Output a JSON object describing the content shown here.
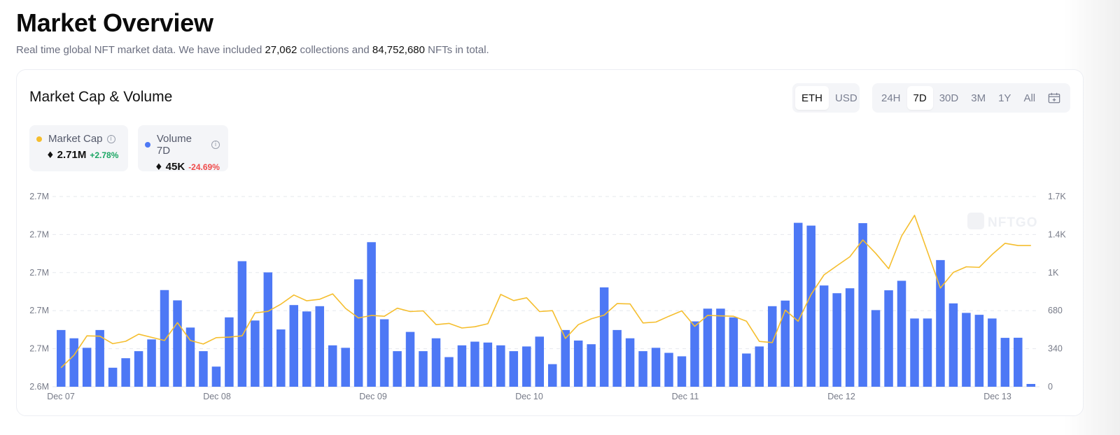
{
  "header": {
    "title": "Market Overview",
    "subtitle_prefix": "Real time global NFT market data. We have included ",
    "collections": "27,062",
    "subtitle_mid": " collections and ",
    "nfts": "84,752,680",
    "subtitle_suffix": " NFTs in total."
  },
  "card": {
    "title": "Market Cap & Volume",
    "currency_toggle": [
      {
        "label": "ETH",
        "active": true
      },
      {
        "label": "USD",
        "active": false
      }
    ],
    "range_toggle": [
      {
        "label": "24H",
        "active": false
      },
      {
        "label": "7D",
        "active": true
      },
      {
        "label": "30D",
        "active": false
      },
      {
        "label": "3M",
        "active": false
      },
      {
        "label": "1Y",
        "active": false
      },
      {
        "label": "All",
        "active": false
      }
    ],
    "calendar_icon": "calendar-icon",
    "legend": {
      "market_cap": {
        "label": "Market Cap",
        "value": "2.71M",
        "change": "+2.78%",
        "color": "#f5be2e",
        "change_color": "#1aa663"
      },
      "volume": {
        "label": "Volume 7D",
        "value": "45K",
        "change": "-24.69%",
        "color": "#4d78f5",
        "change_color": "#ef4b4b"
      }
    },
    "watermark": "NFTGO"
  },
  "chart_data": {
    "type": "bar",
    "x_tick_labels": [
      "Dec 07",
      "Dec 08",
      "Dec 09",
      "Dec 10",
      "Dec 11",
      "Dec 12",
      "Dec 13"
    ],
    "y_left_ticks": [
      "2.6M",
      "2.7M",
      "2.7M",
      "2.7M",
      "2.7M",
      "2.7M"
    ],
    "y_right_ticks": [
      "0",
      "340",
      "680",
      "1K",
      "1.4K",
      "1.7K"
    ],
    "ylim_right": [
      0,
      1700
    ],
    "grid": true,
    "series": [
      {
        "name": "Volume 7D",
        "type": "bar",
        "axis": "right",
        "color": "#4d78f5",
        "values": [
          507,
          433,
          348,
          507,
          170,
          255,
          318,
          423,
          864,
          772,
          529,
          318,
          180,
          620,
          1122,
          592,
          1022,
          512,
          730,
          673,
          720,
          370,
          348,
          960,
          1292,
          603,
          318,
          490,
          318,
          433,
          265,
          370,
          403,
          395,
          370,
          318,
          360,
          448,
          202,
          507,
          413,
          380,
          888,
          507,
          433,
          318,
          348,
          303,
          272,
          584,
          698,
          698,
          620,
          297,
          360,
          720,
          770,
          1465,
          1440,
          905,
          836,
          880,
          1462,
          685,
          862,
          947,
          610,
          610,
          1132,
          745,
          660,
          643,
          610,
          437,
          438,
          25
        ]
      },
      {
        "name": "Market Cap",
        "type": "line",
        "axis": "left_scaled",
        "color": "#f5be2e",
        "values_right_scale": [
          170,
          282,
          455,
          452,
          385,
          406,
          470,
          441,
          413,
          573,
          413,
          382,
          439,
          443,
          455,
          660,
          674,
          738,
          820,
          768,
          782,
          830,
          700,
          615,
          637,
          630,
          702,
          672,
          678,
          555,
          566,
          525,
          536,
          563,
          825,
          770,
          795,
          672,
          680,
          432,
          555,
          607,
          640,
          743,
          740,
          570,
          578,
          630,
          678,
          540,
          638,
          633,
          630,
          586,
          405,
          395,
          685,
          585,
          825,
          1000,
          1082,
          1162,
          1312,
          1192,
          1055,
          1347,
          1532,
          1206,
          882,
          1022,
          1072,
          1067,
          1182,
          1282,
          1262,
          1262
        ]
      }
    ]
  }
}
